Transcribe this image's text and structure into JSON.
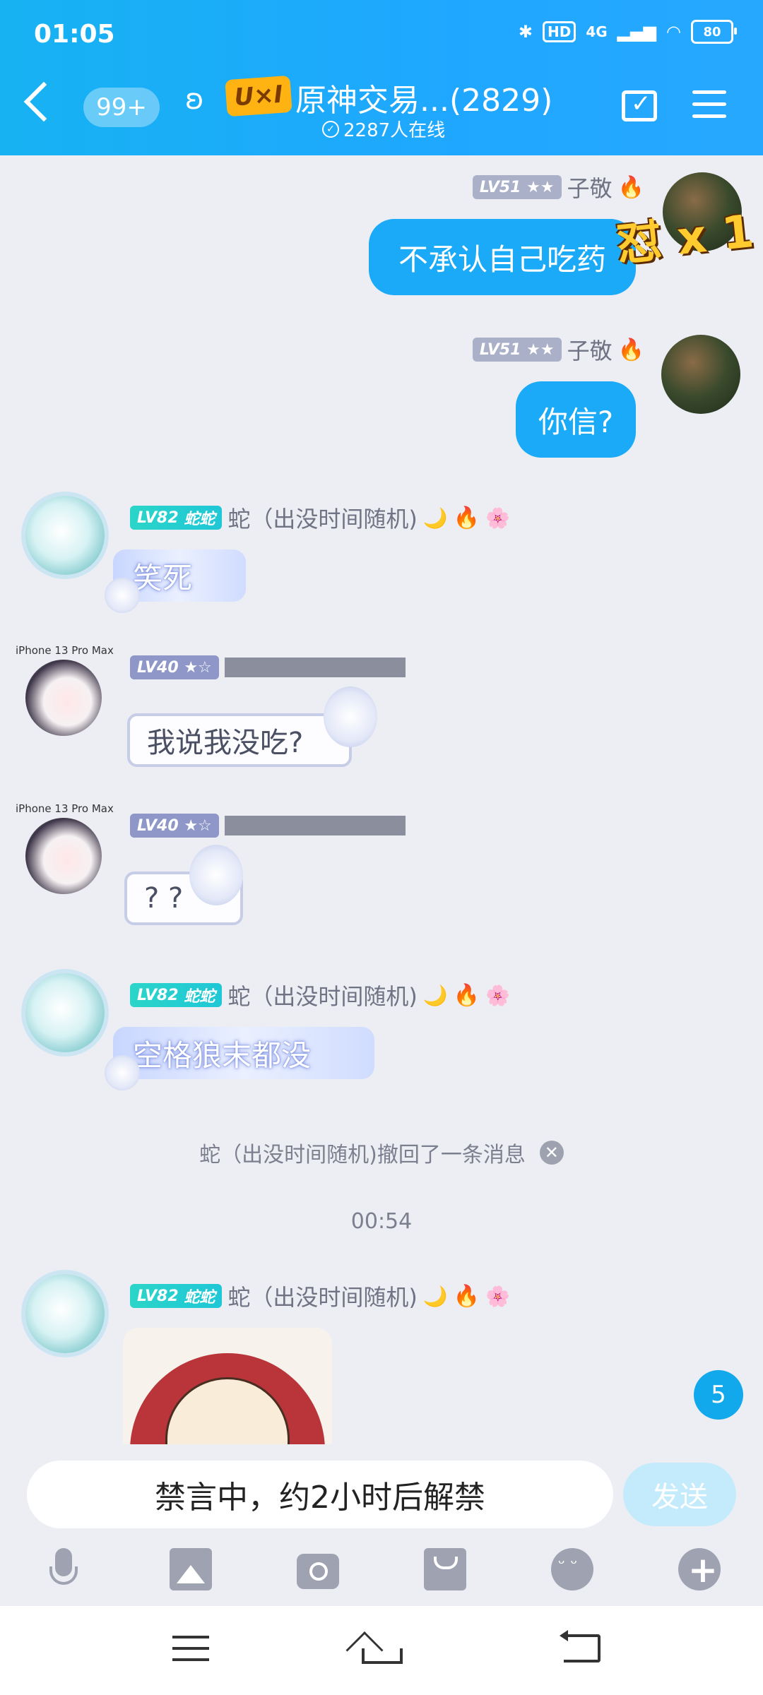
{
  "status_bar": {
    "time": "01:05",
    "hd": "HD",
    "network": "4G",
    "battery": "80"
  },
  "header": {
    "unread_badge": "99+",
    "logo_text": "U×I",
    "title": "原神交易...(2829)",
    "online": "2287人在线"
  },
  "messages": [
    {
      "sender": "子敬",
      "level": "LV51",
      "stars": "★★",
      "text": "不承认自己吃药",
      "badge": "怼 x 1"
    },
    {
      "sender": "子敬",
      "level": "LV51",
      "stars": "★★",
      "text": "你信?"
    },
    {
      "sender": "蛇（出没时间随机)",
      "level": "LV82",
      "title": "蛇蛇",
      "text": "笑死"
    },
    {
      "device": "iPhone 13 Pro Max",
      "level": "LV40",
      "stars": "★☆",
      "text": "我说我没吃?"
    },
    {
      "device": "iPhone 13 Pro Max",
      "level": "LV40",
      "stars": "★☆",
      "text": "? ?"
    },
    {
      "sender": "蛇（出没时间随机)",
      "level": "LV82",
      "title": "蛇蛇",
      "text": "空格狼末都没"
    },
    {
      "sender": "蛇（出没时间随机)",
      "level": "LV82",
      "title": "蛇蛇",
      "type": "sticker"
    }
  ],
  "system": {
    "recall_notice": "蛇（出没时间随机)撤回了一条消息",
    "timestamp": "00:54"
  },
  "new_messages_count": "5",
  "input": {
    "placeholder": "禁言中，约2小时后解禁",
    "send_label": "发送"
  },
  "toolbar": [
    "mic-icon",
    "image-icon",
    "camera-icon",
    "envelope-icon",
    "emoji-icon",
    "plus-icon"
  ],
  "colors": {
    "header": "#1fa7ff",
    "bubble_self": "#1aaaf8",
    "level_teal": "#2bd5c8",
    "background": "#edeef4"
  }
}
